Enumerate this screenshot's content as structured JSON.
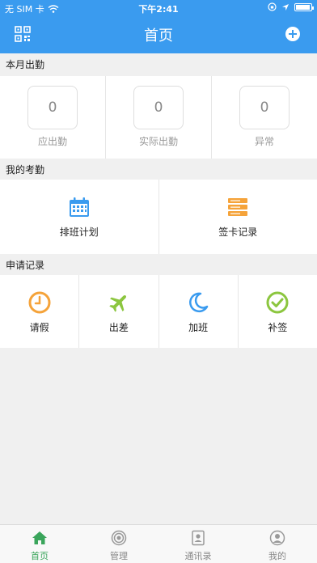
{
  "status_bar": {
    "carrier": "无 SIM 卡",
    "time": "下午2:41",
    "battery_level": 0.95
  },
  "header": {
    "title": "首页",
    "left_icon": "qr-code-icon",
    "right_icon": "plus-circle-icon",
    "background_color": "#3a9bef"
  },
  "month_attendance": {
    "heading": "本月出勤",
    "stats": [
      {
        "value": "0",
        "label": "应出勤"
      },
      {
        "value": "0",
        "label": "实际出勤"
      },
      {
        "value": "0",
        "label": "异常"
      }
    ]
  },
  "my_attendance": {
    "heading": "我的考勤",
    "items": [
      {
        "label": "排班计划",
        "icon": "calendar-icon",
        "color": "#3a9bef"
      },
      {
        "label": "签卡记录",
        "icon": "server-record-icon",
        "color": "#f5a33a"
      }
    ]
  },
  "applications": {
    "heading": "申请记录",
    "items": [
      {
        "label": "请假",
        "icon": "clock-icon",
        "color": "#f5a33a"
      },
      {
        "label": "出差",
        "icon": "airplane-icon",
        "color": "#8cc63f"
      },
      {
        "label": "加班",
        "icon": "moon-icon",
        "color": "#3a9bef"
      },
      {
        "label": "补签",
        "icon": "check-circle-icon",
        "color": "#8cc63f"
      }
    ]
  },
  "tab_bar": {
    "tabs": [
      {
        "label": "首页",
        "icon": "home-icon",
        "active": true
      },
      {
        "label": "管理",
        "icon": "target-icon",
        "active": false
      },
      {
        "label": "通讯录",
        "icon": "contacts-icon",
        "active": false
      },
      {
        "label": "我的",
        "icon": "user-icon",
        "active": false
      }
    ],
    "active_color": "#3aa55b"
  }
}
